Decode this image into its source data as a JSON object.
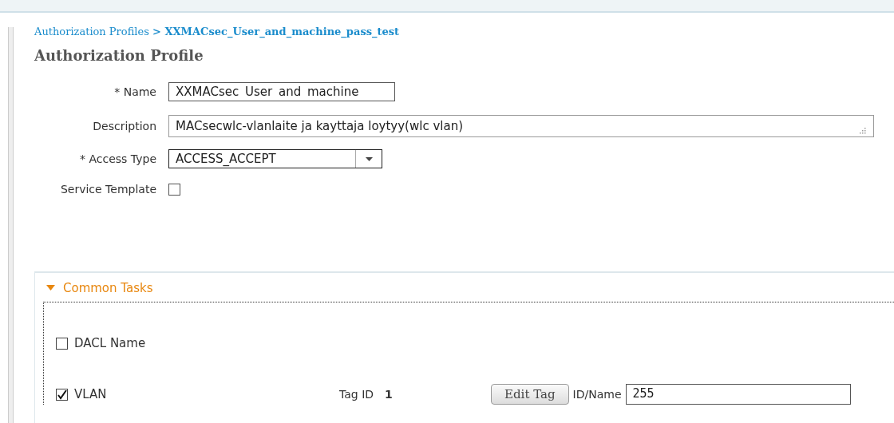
{
  "breadcrumb": {
    "parent": "Authorization Profiles",
    "separator": ">",
    "current": "XXMACsec_User_and_machine_pass_test"
  },
  "title": "Authorization Profile",
  "fields": [
    {
      "kind": "text",
      "label": "* Name",
      "value": "XXMACsec User and machine"
    },
    {
      "kind": "textarea",
      "label": "Description",
      "value": "MACsecwlc-vlanlaite ja kayttaja loytyy(wlc vlan)"
    },
    {
      "kind": "select",
      "label": "* Access Type",
      "value": "ACCESS_ACCEPT"
    },
    {
      "kind": "checkbox",
      "label": "Service Template",
      "checked": false
    }
  ],
  "common_tasks": {
    "title": "Common Tasks",
    "expanded": true,
    "tasks": [
      {
        "kind": "plain",
        "label": "DACL Name",
        "checked": false
      },
      {
        "kind": "vlan",
        "label": "VLAN",
        "checked": true,
        "tag_label": "Tag ID",
        "tag_value": "1",
        "button": "Edit Tag",
        "id_label": "ID/Name",
        "id_value": "255"
      }
    ]
  }
}
